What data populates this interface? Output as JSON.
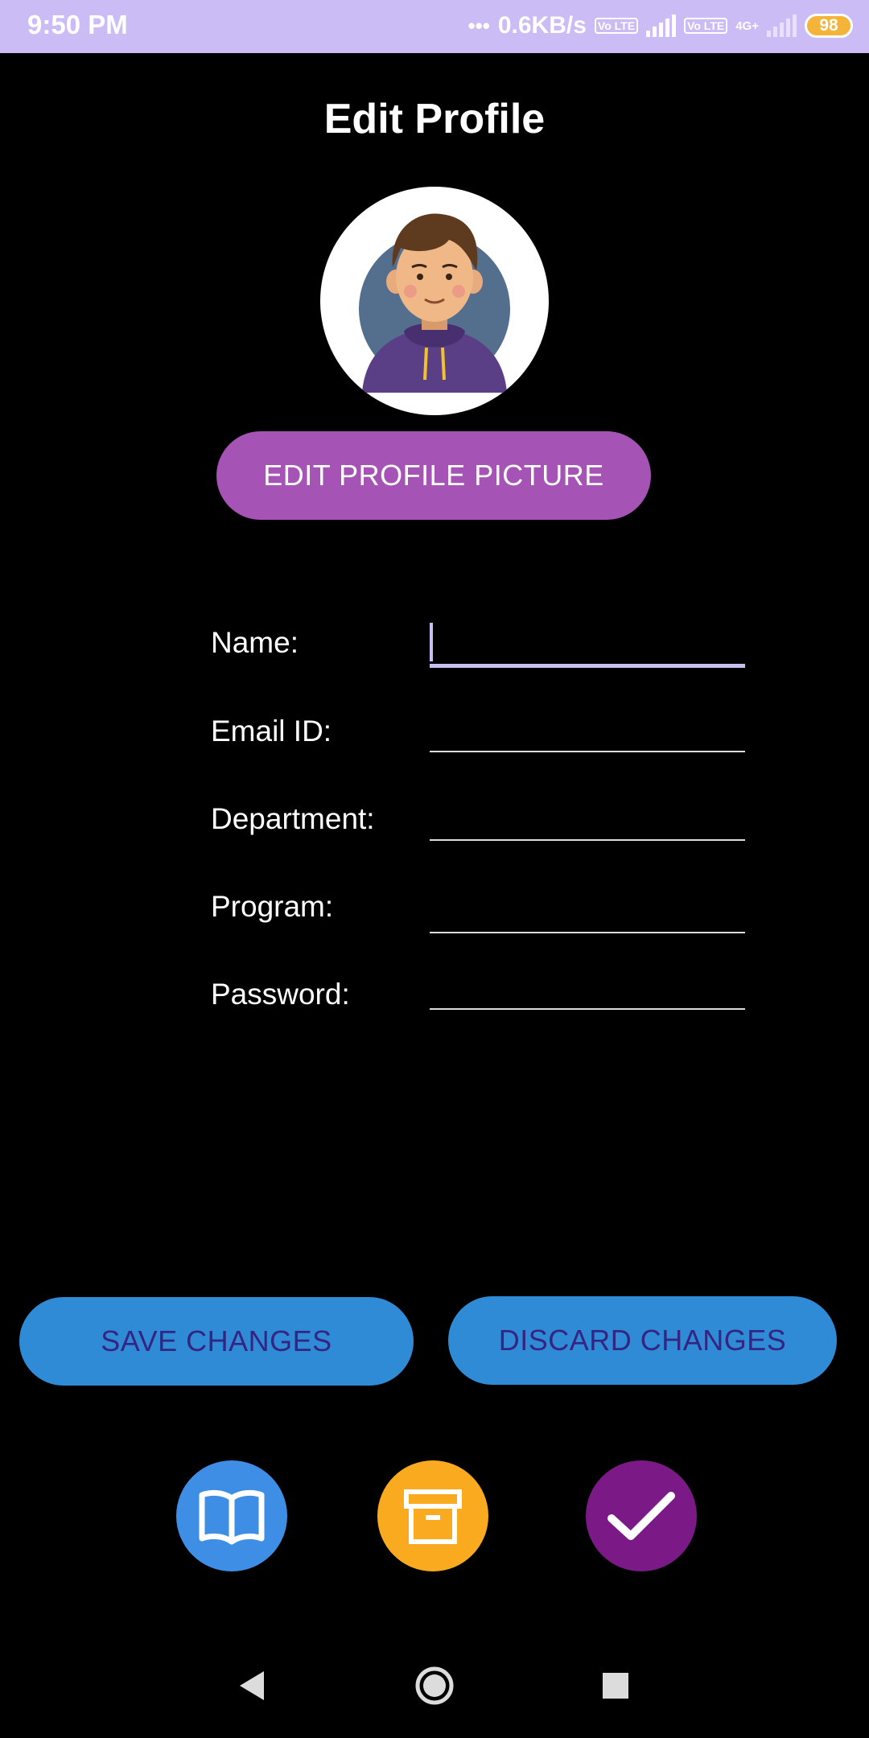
{
  "status_bar": {
    "time": "9:50 PM",
    "network_speed": "0.6KB/s",
    "volte_1": "Vo LTE",
    "volte_2": "Vo LTE",
    "network_type": "4G+",
    "battery": "98",
    "icons": [
      "dots-icon",
      "signal-icon",
      "signal-icon",
      "battery-icon"
    ]
  },
  "header": {
    "title": "Edit Profile"
  },
  "profile": {
    "avatar_icon": "avatar-illustration",
    "edit_picture_label": "EDIT PROFILE PICTURE"
  },
  "form": {
    "fields": [
      {
        "label": "Name:",
        "value": ""
      },
      {
        "label": "Email ID:",
        "value": ""
      },
      {
        "label": "Department:",
        "value": ""
      },
      {
        "label": "Program:",
        "value": ""
      },
      {
        "label": "Password:",
        "value": ""
      }
    ]
  },
  "actions": {
    "save_label": "SAVE CHANGES",
    "discard_label": "DISCARD CHANGES"
  },
  "bottom_icons": [
    {
      "icon": "book-icon",
      "color": "#3f8ee6"
    },
    {
      "icon": "archive-icon",
      "color": "#f9aa1e"
    },
    {
      "icon": "check-icon",
      "color": "#7b1a86"
    }
  ],
  "navigation": {
    "icons": [
      "back-icon",
      "home-icon",
      "recents-icon"
    ]
  },
  "colors": {
    "status_bar": "#cbbcf6",
    "accent_purple": "#a653b6",
    "button_blue": "#2f8bd6",
    "button_text": "#352582",
    "background": "#000000"
  }
}
